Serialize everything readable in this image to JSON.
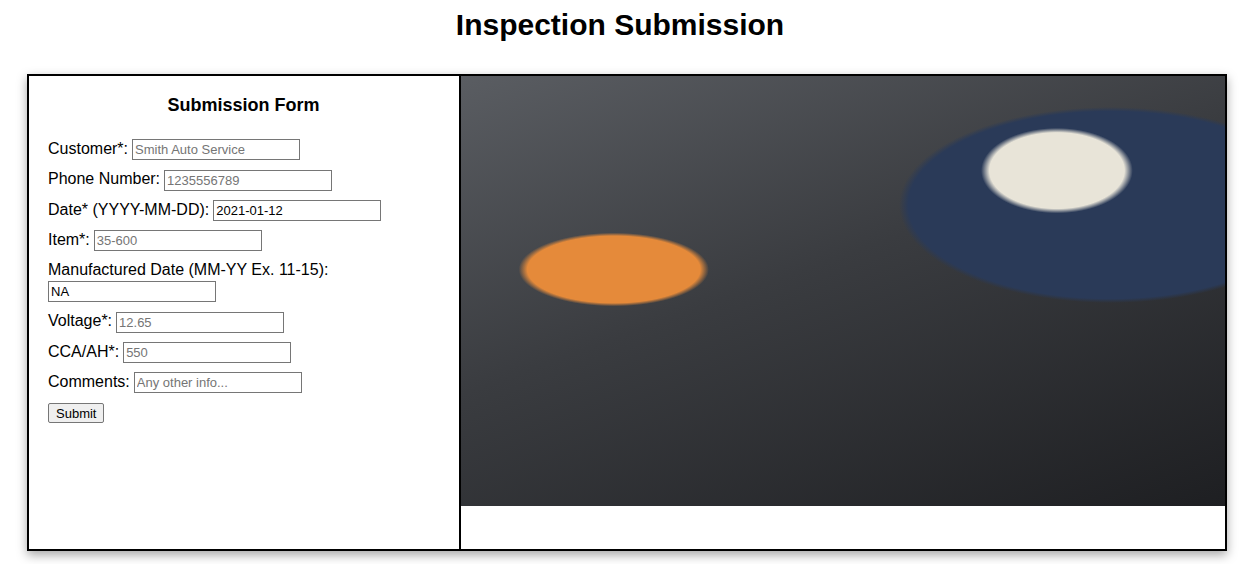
{
  "page": {
    "title": "Inspection Submission"
  },
  "form": {
    "title": "Submission Form",
    "fields": [
      {
        "label": "Customer*:",
        "placeholder": "Smith Auto Service",
        "value": ""
      },
      {
        "label": "Phone Number:",
        "placeholder": "1235556789",
        "value": ""
      },
      {
        "label": "Date* (YYYY-MM-DD):",
        "placeholder": "",
        "value": "2021-01-12"
      },
      {
        "label": "Item*:",
        "placeholder": "35-600",
        "value": ""
      },
      {
        "label": "Manufactured Date (MM-YY Ex. 11-15):",
        "placeholder": "",
        "value": "NA"
      },
      {
        "label": "Voltage*:",
        "placeholder": "12.65",
        "value": ""
      },
      {
        "label": "CCA/AH*:",
        "placeholder": "550",
        "value": ""
      },
      {
        "label": "Comments:",
        "placeholder": "Any other info...",
        "value": ""
      }
    ],
    "submit": "Submit"
  }
}
